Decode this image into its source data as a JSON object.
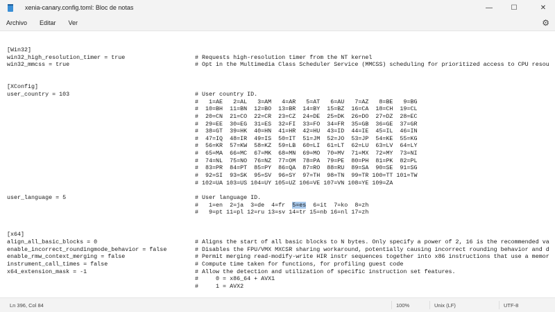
{
  "window": {
    "title": "xenia-canary.config.toml: Bloc de notas",
    "minimize": "—",
    "maximize": "☐",
    "close": "✕"
  },
  "menu": {
    "items": [
      "Archivo",
      "Editar",
      "Ver"
    ],
    "settings_icon": "gear-icon"
  },
  "editor": {
    "win32": {
      "header": "[Win32]",
      "lines": [
        {
          "key": "win32_high_resolution_timer = true",
          "comment": "# Requests high-resolution timer from the NT kernel"
        },
        {
          "key": "win32_mmcss = true",
          "comment": "# Opt in the Multimedia Class Scheduler Service (MMCSS) scheduling for prioritized access to CPU resou"
        }
      ]
    },
    "xconfig": {
      "header": "[XConfig]",
      "user_country": {
        "key": "user_country = 103",
        "comment": "# User country ID."
      },
      "country_rows": [
        [
          "1=AE",
          "2=AL",
          "3=AM",
          "4=AR",
          "5=AT",
          "6=AU",
          "7=AZ",
          "8=BE",
          "9=BG"
        ],
        [
          "10=BH",
          "11=BN",
          "12=BO",
          "13=BR",
          "14=BY",
          "15=BZ",
          "16=CA",
          "18=CH",
          "19=CL"
        ],
        [
          "20=CN",
          "21=CO",
          "22=CR",
          "23=CZ",
          "24=DE",
          "25=DK",
          "26=DO",
          "27=DZ",
          "28=EC"
        ],
        [
          "29=EE",
          "30=EG",
          "31=ES",
          "32=FI",
          "33=FO",
          "34=FR",
          "35=GB",
          "36=GE",
          "37=GR"
        ],
        [
          "38=GT",
          "39=HK",
          "40=HN",
          "41=HR",
          "42=HU",
          "43=ID",
          "44=IE",
          "45=IL",
          "46=IN"
        ],
        [
          "47=IQ",
          "48=IR",
          "49=IS",
          "50=IT",
          "51=JM",
          "52=JO",
          "53=JP",
          "54=KE",
          "55=KG"
        ],
        [
          "56=KR",
          "57=KW",
          "58=KZ",
          "59=LB",
          "60=LI",
          "61=LT",
          "62=LU",
          "63=LV",
          "64=LY"
        ],
        [
          "65=MA",
          "66=MC",
          "67=MK",
          "68=MN",
          "69=MO",
          "70=MV",
          "71=MX",
          "72=MY",
          "73=NI"
        ],
        [
          "74=NL",
          "75=NO",
          "76=NZ",
          "77=OM",
          "78=PA",
          "79=PE",
          "80=PH",
          "81=PK",
          "82=PL"
        ],
        [
          "83=PR",
          "84=PT",
          "85=PY",
          "86=QA",
          "87=RO",
          "88=RU",
          "89=SA",
          "90=SE",
          "91=SG"
        ],
        [
          "92=SI",
          "93=SK",
          "95=SV",
          "96=SY",
          "97=TH",
          "98=TN",
          "99=TR",
          "100=TT",
          "101=TW"
        ],
        [
          "102=UA",
          "103=US",
          "104=UY",
          "105=UZ",
          "106=VE",
          "107=VN",
          "108=YE",
          "109=ZA"
        ]
      ],
      "user_language": {
        "key": "user_language = 5",
        "comment": "# User language ID."
      },
      "lang_row1": {
        "before": "#   1=en  2=ja  3=de  4=fr  ",
        "selected": "5=es",
        "after": "  6=it  7=ko  8=zh"
      },
      "lang_row2": "#   9=pt 11=pl 12=ru 13=sv 14=tr 15=nb 16=nl 17=zh"
    },
    "x64": {
      "header": "[x64]",
      "lines": [
        {
          "key": "align_all_basic_blocks = 0",
          "comment": "# Aligns the start of all basic blocks to N bytes. Only specify a power of 2, 16 is the recommended va"
        },
        {
          "key": "enable_incorrect_roundingmode_behavior = false",
          "comment": "# Disables the FPU/VMX MXCSR sharing workaround, potentially causing incorrect rounding behavior and d"
        },
        {
          "key": "enable_rmw_context_merging = false",
          "comment": "# Permit merging read-modify-write HIR instr sequences together into x86 instructions that use a memor"
        },
        {
          "key": "instrument_call_times = false",
          "comment": "# Compute time taken for functions, for profiling guest code"
        },
        {
          "key": "x64_extension_mask = -1",
          "comment": "# Allow the detection and utilization of specific instruction set features."
        },
        {
          "key": "",
          "comment": "#     0 = x86_64 + AVX1"
        },
        {
          "key": "",
          "comment": "#     1 = AVX2"
        }
      ]
    }
  },
  "status": {
    "position": "Ln 396, Col 84",
    "zoom": "100%",
    "line_ending": "Unix (LF)",
    "encoding": "UTF-8"
  }
}
